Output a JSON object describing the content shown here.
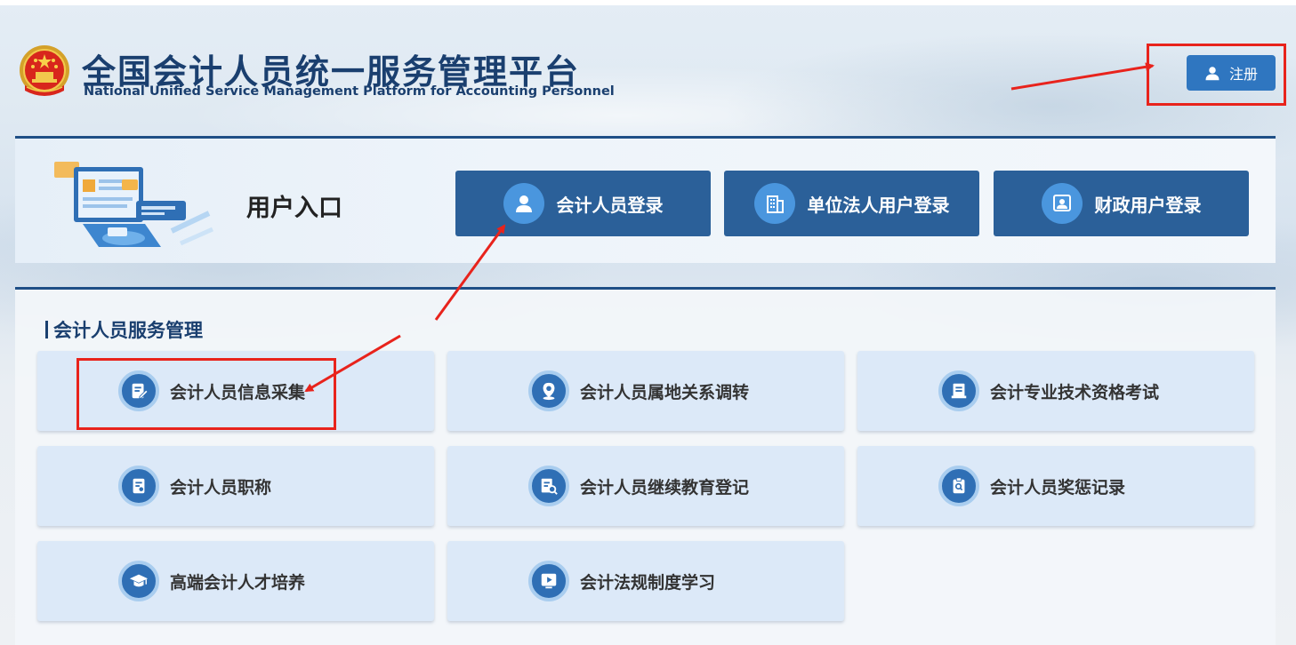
{
  "header": {
    "title_cn": "全国会计人员统一服务管理平台",
    "title_en": "National Unified Service Management Platform for Accounting Personnel",
    "register_label": "注册",
    "register_icon": "user-icon"
  },
  "entry": {
    "title": "用户入口",
    "buttons": [
      {
        "label": "会计人员登录",
        "icon": "user-icon"
      },
      {
        "label": "单位法人用户登录",
        "icon": "building-icon"
      },
      {
        "label": "财政用户登录",
        "icon": "monitor-user-icon"
      }
    ]
  },
  "services": {
    "title": "会计人员服务管理",
    "items": [
      {
        "label": "会计人员信息采集",
        "icon": "edit-form-icon"
      },
      {
        "label": "会计人员属地关系调转",
        "icon": "location-icon"
      },
      {
        "label": "会计专业技术资格考试",
        "icon": "exam-icon"
      },
      {
        "label": "会计人员职称",
        "icon": "certificate-icon"
      },
      {
        "label": "会计人员继续教育登记",
        "icon": "search-document-icon"
      },
      {
        "label": "会计人员奖惩记录",
        "icon": "clipboard-search-icon"
      },
      {
        "label": "高端会计人才培养",
        "icon": "graduation-cap-icon"
      },
      {
        "label": "会计法规制度学习",
        "icon": "play-icon"
      }
    ]
  },
  "colors": {
    "primary_dark": "#2b6099",
    "primary": "#2f76c0",
    "heading": "#1a3f6f",
    "annotation_red": "#e8231c",
    "card_bg": "#dce9f8"
  }
}
